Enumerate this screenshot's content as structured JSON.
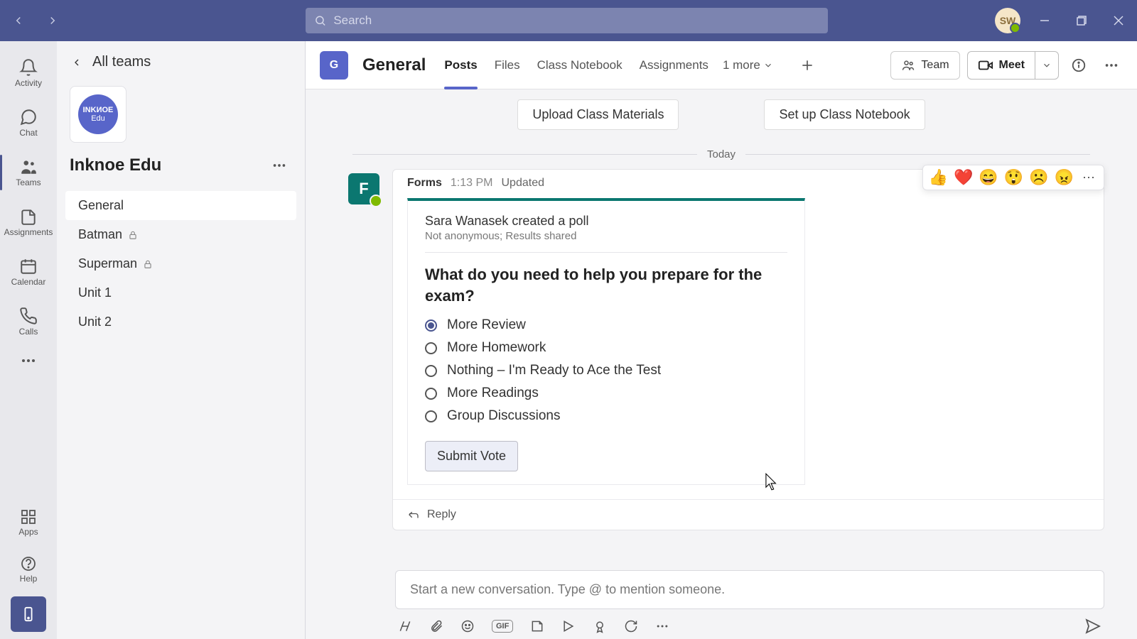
{
  "titlebar": {
    "search_placeholder": "Search",
    "avatar_initials": "SW"
  },
  "rail": {
    "items": [
      {
        "label": "Activity"
      },
      {
        "label": "Chat"
      },
      {
        "label": "Teams"
      },
      {
        "label": "Assignments"
      },
      {
        "label": "Calendar"
      },
      {
        "label": "Calls"
      }
    ],
    "apps_label": "Apps",
    "help_label": "Help"
  },
  "sidepanel": {
    "back_label": "All teams",
    "team_name": "Inknoe Edu",
    "team_logo_line1": "INKИOE",
    "team_logo_line2": "Edu",
    "channels": [
      {
        "label": "General",
        "active": true,
        "locked": false
      },
      {
        "label": "Batman",
        "active": false,
        "locked": true
      },
      {
        "label": "Superman",
        "active": false,
        "locked": true
      },
      {
        "label": "Unit 1",
        "active": false,
        "locked": false
      },
      {
        "label": "Unit 2",
        "active": false,
        "locked": false
      }
    ]
  },
  "header": {
    "channel_initial": "G",
    "channel_name": "General",
    "tabs": [
      {
        "label": "Posts",
        "active": true
      },
      {
        "label": "Files",
        "active": false
      },
      {
        "label": "Class Notebook",
        "active": false
      },
      {
        "label": "Assignments",
        "active": false
      }
    ],
    "more_tabs": "1 more",
    "team_btn": "Team",
    "meet_btn": "Meet"
  },
  "setup": {
    "upload_btn": "Upload Class Materials",
    "notebook_btn": "Set up Class Notebook"
  },
  "date_separator": "Today",
  "post": {
    "app": "Forms",
    "time": "1:13 PM",
    "status": "Updated",
    "desc": "Sara Wanasek created a poll",
    "sub": "Not anonymous; Results shared",
    "question": "What do you need to help you prepare for the exam?",
    "options": [
      {
        "label": "More Review",
        "checked": true
      },
      {
        "label": "More Homework",
        "checked": false
      },
      {
        "label": "Nothing – I'm Ready to Ace the Test",
        "checked": false
      },
      {
        "label": "More Readings",
        "checked": false
      },
      {
        "label": "Group Discussions",
        "checked": false
      }
    ],
    "submit_btn": "Submit Vote",
    "reply": "Reply"
  },
  "reactions": [
    "👍",
    "❤️",
    "😄",
    "😲",
    "☹️",
    "😠"
  ],
  "composer": {
    "placeholder": "Start a new conversation. Type @ to mention someone."
  }
}
